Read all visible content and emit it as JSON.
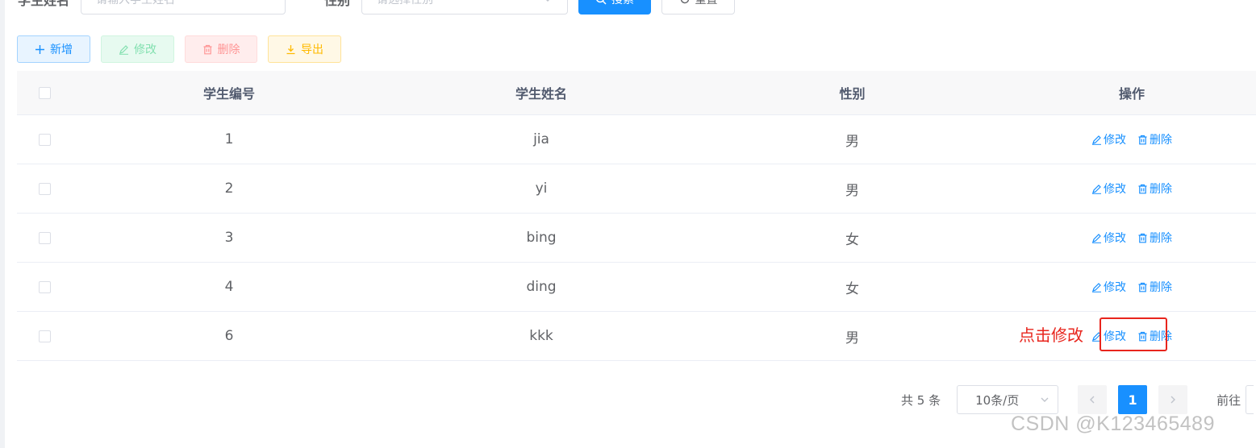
{
  "search": {
    "name_label": "学生姓名",
    "name_placeholder": "请输入学生姓名",
    "gender_label": "性别",
    "gender_placeholder": "请选择性别",
    "search_button": "搜索",
    "reset_button": "重置"
  },
  "toolbar": {
    "add_label": "新增",
    "edit_label": "修改",
    "delete_label": "删除",
    "export_label": "导出"
  },
  "table": {
    "headers": {
      "id": "学生编号",
      "name": "学生姓名",
      "gender": "性别",
      "ops": "操作"
    },
    "rows": [
      {
        "id": "1",
        "name": "jia",
        "gender": "男",
        "edit": "修改",
        "delete": "删除"
      },
      {
        "id": "2",
        "name": "yi",
        "gender": "男",
        "edit": "修改",
        "delete": "删除"
      },
      {
        "id": "3",
        "name": "bing",
        "gender": "女",
        "edit": "修改",
        "delete": "删除"
      },
      {
        "id": "4",
        "name": "ding",
        "gender": "女",
        "edit": "修改",
        "delete": "删除"
      },
      {
        "id": "6",
        "name": "kkk",
        "gender": "男",
        "edit": "修改",
        "delete": "删除"
      }
    ]
  },
  "annotation": {
    "text": "点击修改"
  },
  "pagination": {
    "total": "共 5 条",
    "page_size": "10条/页",
    "current_page": "1",
    "goto_label": "前往"
  },
  "watermark": "CSDN @K123465489",
  "colors": {
    "primary": "#1890ff",
    "annotation": "#e8251d"
  }
}
